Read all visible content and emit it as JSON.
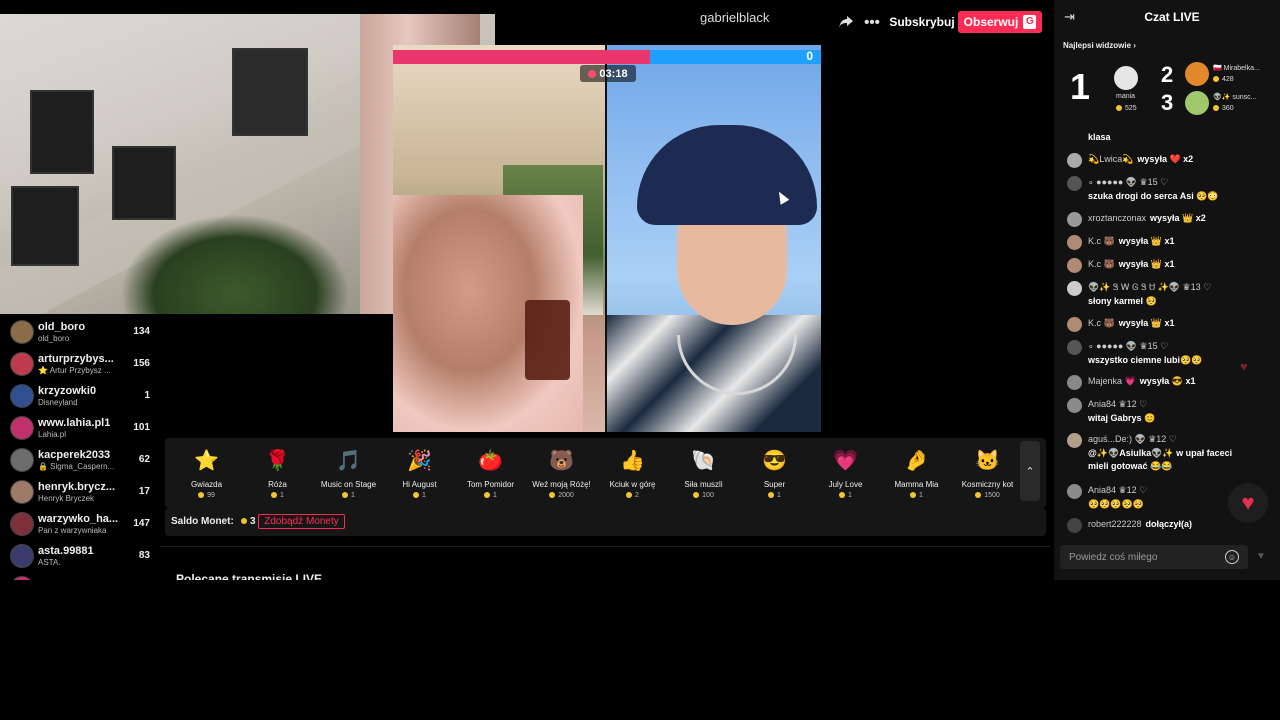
{
  "header": {
    "streamer": "gabrielblack",
    "share_icon": "share-arrow-icon",
    "more_icon": "ellipsis-icon",
    "subscribe_label": "Subskrybuj",
    "follow_label": "Obserwuj",
    "follow_key": "G"
  },
  "battle": {
    "timer": "03:18",
    "score_right": "0",
    "score_left_fraction": 0.6,
    "colors": {
      "left": "#e9376d",
      "right": "#1fa0ff"
    }
  },
  "viewers": [
    {
      "name": "old_boro",
      "sub": "old_boro",
      "count": "134",
      "color": "#8a6b4a"
    },
    {
      "name": "arturprzybys...",
      "sub": "⭐ Artur Przybysz ...",
      "count": "156",
      "color": "#c03a4d"
    },
    {
      "name": "krzyzowki0",
      "sub": "Disneyland",
      "count": "1",
      "color": "#2f4f8f"
    },
    {
      "name": "www.lahia.pl1",
      "sub": "Lahia.pl",
      "count": "101",
      "color": "#c0306b"
    },
    {
      "name": "kacperek2033",
      "sub": "🔒 Sigma_Caspern...",
      "count": "62",
      "color": "#6d6d6d"
    },
    {
      "name": "henryk.brycz...",
      "sub": "Henryk Bryczek",
      "count": "17",
      "color": "#a07a68"
    },
    {
      "name": "warzywko_ha...",
      "sub": "Pan z warzywniaka",
      "count": "147",
      "color": "#7d2f3a"
    },
    {
      "name": "asta.99881",
      "sub": "ASTA.",
      "count": "83",
      "color": "#3b3b6b"
    },
    {
      "name": "...",
      "sub": "",
      "count": "",
      "color": "#c0306b"
    }
  ],
  "gifts": [
    {
      "label": "Gwiazda",
      "price": "99",
      "icon": "⭐",
      "name": "star-gift-icon"
    },
    {
      "label": "Róża",
      "price": "1",
      "icon": "🌹",
      "name": "rose-gift-icon"
    },
    {
      "label": "Music on Stage",
      "price": "1",
      "icon": "🎵",
      "name": "music-gift-icon"
    },
    {
      "label": "Hi August",
      "price": "1",
      "icon": "🎉",
      "name": "hi-august-gift-icon"
    },
    {
      "label": "Tom Pomidor",
      "price": "1",
      "icon": "🍅",
      "name": "tomato-gift-icon"
    },
    {
      "label": "Weź moją Różę!",
      "price": "2000",
      "icon": "🐻",
      "name": "bear-gift-icon"
    },
    {
      "label": "Kciuk w górę",
      "price": "2",
      "icon": "👍",
      "name": "thumbs-up-gift-icon"
    },
    {
      "label": "Siła muszli",
      "price": "100",
      "icon": "🐚",
      "name": "shell-gift-icon"
    },
    {
      "label": "Super",
      "price": "1",
      "icon": "😎",
      "name": "super-gift-icon"
    },
    {
      "label": "July Love",
      "price": "1",
      "icon": "💗",
      "name": "july-love-gift-icon"
    },
    {
      "label": "Mamma Mia",
      "price": "1",
      "icon": "🤌",
      "name": "mamma-mia-gift-icon"
    },
    {
      "label": "Kosmiczny kot",
      "price": "1500",
      "icon": "🐱",
      "name": "space-cat-gift-icon"
    }
  ],
  "wallet": {
    "label": "Saldo Monet:",
    "value": "3",
    "get_coins": "Zdobądź Monety"
  },
  "recommended": {
    "title": "Polecane transmisje LIVE"
  },
  "chat": {
    "title": "Czat LIVE",
    "top_viewers_title": "Najlepsi widzowie",
    "ranks": [
      {
        "rank": "1",
        "name": "mania",
        "score": "525",
        "color": "#e6e6e6"
      },
      {
        "rank": "2",
        "name": "🇵🇱 Mirabelka...",
        "score": "428",
        "color": "#e08a2b"
      },
      {
        "rank": "3",
        "name": "👽✨ sunsc...",
        "score": "360",
        "color": "#9fc76b"
      }
    ],
    "messages": [
      {
        "user": "",
        "text": "klasa",
        "avatar": "#777"
      },
      {
        "user": "💫Lwica💫",
        "text": "wysyła ❤️ x2",
        "avatar": "#aaa",
        "inline": true
      },
      {
        "user": "∘ ●●●●● 👽 ♛15 ♡",
        "text": "szuka drogi do serca Asi 🥺😳",
        "avatar": "#555"
      },
      {
        "user": "xroztanczonax",
        "text": "wysyła 👑 x2",
        "avatar": "#999",
        "inline": true
      },
      {
        "user": "K.c 🐻",
        "text": "wysyła 👑 x1",
        "avatar": "#b08a74",
        "inline": true
      },
      {
        "user": "K.c 🐻",
        "text": "wysyła 👑 x1",
        "avatar": "#b08a74",
        "inline": true
      },
      {
        "user": "👽✨ Ꮥ Ꮃ Ꮆ Ꮥ Ꮜ ✨👽 ♛13 ♡",
        "text": "słony karmel 🥺",
        "avatar": "#ccc"
      },
      {
        "user": "K.c 🐻",
        "text": "wysyła 👑 x1",
        "avatar": "#b08a74",
        "inline": true
      },
      {
        "user": "∘ ●●●●● 👽 ♛15 ♡",
        "text": "wszystko ciemne lubi🥺🥺",
        "avatar": "#555"
      },
      {
        "user": "Majenka 💗",
        "text": "wysyła 😎 x1",
        "avatar": "#888",
        "inline": true
      },
      {
        "user": "Ania84 ♛12 ♡",
        "text": "witaj Gabrys 😊",
        "avatar": "#8a8a8a"
      },
      {
        "user": "aguś...De:) 👽 ♛12 ♡",
        "text": "@✨👽Asiulka👽✨ w upał faceci",
        "text2": "mieli gotować 😂😂",
        "avatar": "#b0a08a"
      },
      {
        "user": "Ania84 ♛12 ♡",
        "text": "🥺🥺🥺🥺🥺",
        "avatar": "#8a8a8a"
      },
      {
        "user": "robert222228",
        "text": "dołączył(a)",
        "avatar": "#444",
        "inline": true
      }
    ],
    "input_placeholder": "Powiedz coś miłego",
    "emoji_icon": "smiley-icon",
    "send_icon": "send-icon",
    "like_icon": "heart-icon"
  }
}
